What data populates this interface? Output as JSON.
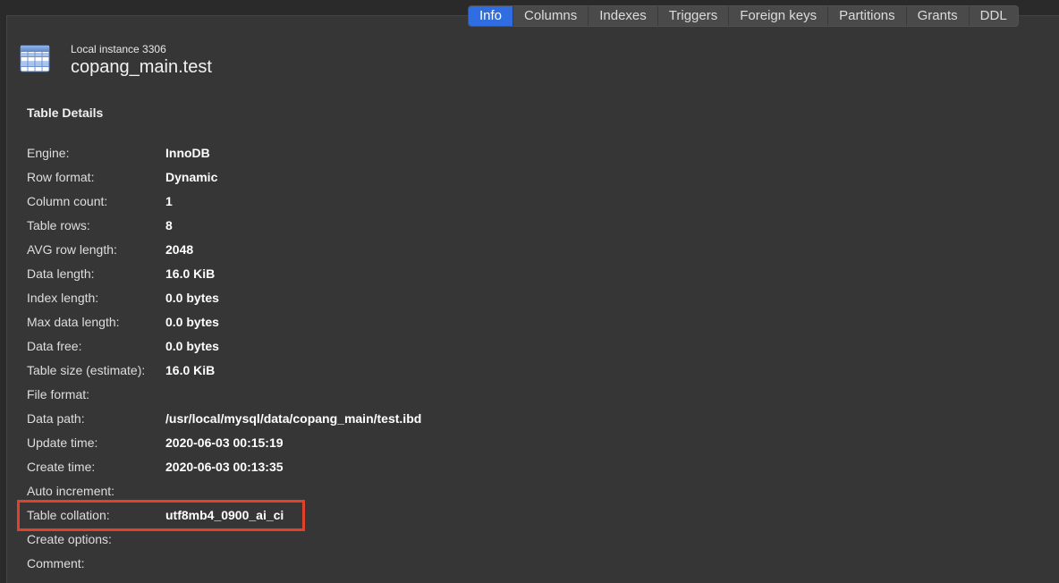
{
  "tabs": [
    {
      "label": "Info",
      "active": true
    },
    {
      "label": "Columns",
      "active": false
    },
    {
      "label": "Indexes",
      "active": false
    },
    {
      "label": "Triggers",
      "active": false
    },
    {
      "label": "Foreign keys",
      "active": false
    },
    {
      "label": "Partitions",
      "active": false
    },
    {
      "label": "Grants",
      "active": false
    },
    {
      "label": "DDL",
      "active": false
    }
  ],
  "header": {
    "icon": "table-icon",
    "instance": "Local instance 3306",
    "table_name": "copang_main.test"
  },
  "section_title": "Table Details",
  "details": [
    {
      "label": "Engine:",
      "value": "InnoDB"
    },
    {
      "label": "Row format:",
      "value": "Dynamic"
    },
    {
      "label": "Column count:",
      "value": "1"
    },
    {
      "label": "Table rows:",
      "value": "8"
    },
    {
      "label": "AVG row length:",
      "value": "2048"
    },
    {
      "label": "Data length:",
      "value": "16.0 KiB"
    },
    {
      "label": "Index length:",
      "value": "0.0 bytes"
    },
    {
      "label": "Max data length:",
      "value": "0.0 bytes"
    },
    {
      "label": "Data free:",
      "value": "0.0 bytes"
    },
    {
      "label": "Table size (estimate):",
      "value": "16.0 KiB"
    },
    {
      "label": "File format:",
      "value": ""
    },
    {
      "label": "Data path:",
      "value": "/usr/local/mysql/data/copang_main/test.ibd"
    },
    {
      "label": "Update time:",
      "value": "2020-06-03 00:15:19"
    },
    {
      "label": "Create time:",
      "value": "2020-06-03 00:13:35"
    },
    {
      "label": "Auto increment:",
      "value": ""
    },
    {
      "label": "Table collation:",
      "value": "utf8mb4_0900_ai_ci"
    },
    {
      "label": "Create options:",
      "value": ""
    },
    {
      "label": "Comment:",
      "value": ""
    }
  ],
  "colors": {
    "active_tab": "#2f6de0",
    "highlight": "#e0412a",
    "background": "#363636"
  }
}
